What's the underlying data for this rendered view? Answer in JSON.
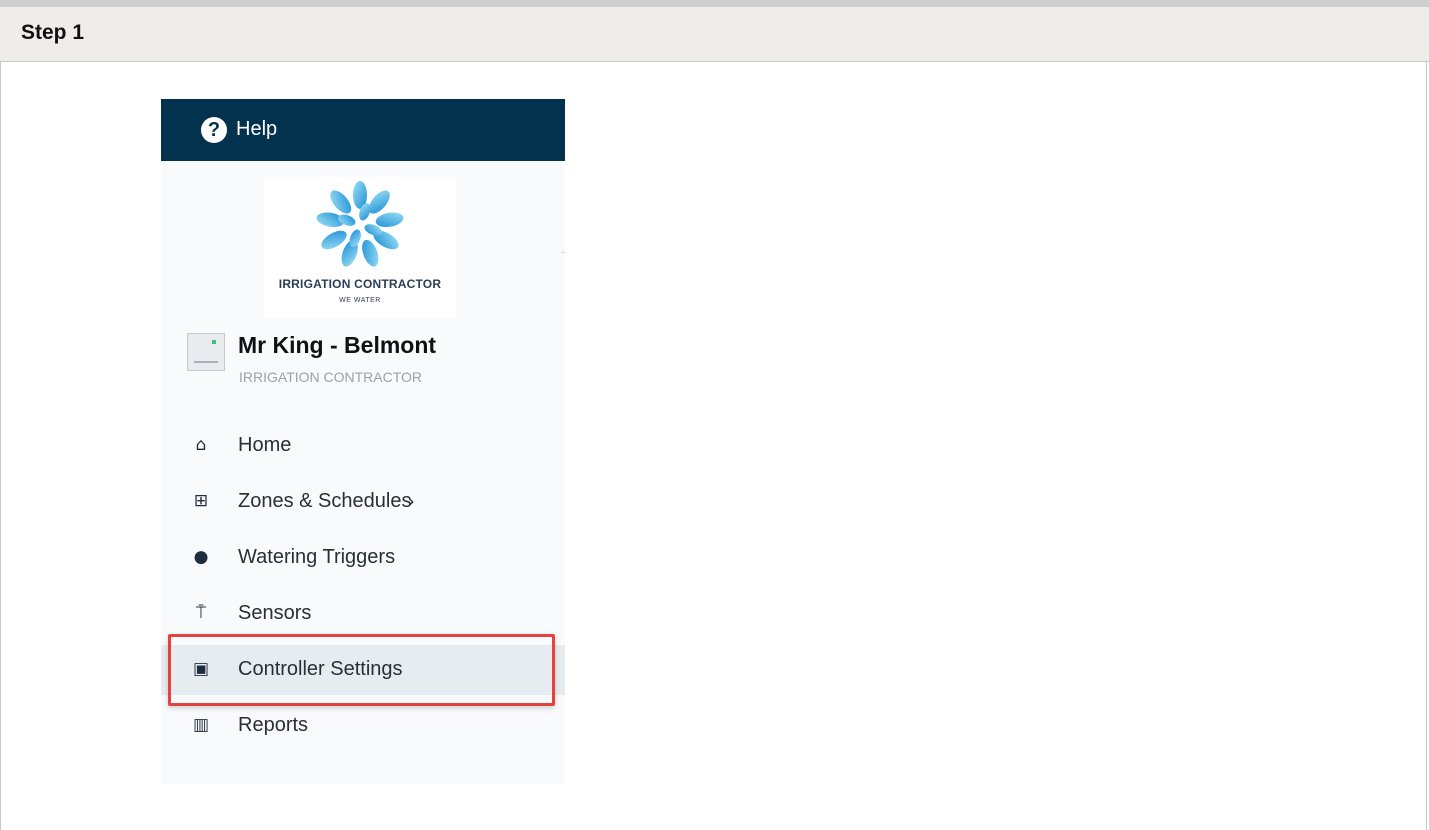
{
  "step": {
    "title": "Step 1"
  },
  "app": {
    "help": {
      "label": "Help",
      "icon": "question-circle-icon"
    },
    "logo": {
      "name": "IRRIGATION CONTRACTOR",
      "tagline": "WE WATER",
      "icon": "water-splash-icon"
    },
    "controller": {
      "name": "Mr King - Belmont",
      "company": "IRRIGATION CONTRACTOR",
      "icon": "controller-device-icon"
    },
    "nav": [
      {
        "label": "Home",
        "icon": "home-icon",
        "glyph": "⌂"
      },
      {
        "label": "Zones & Schedules",
        "icon": "grid-icon",
        "glyph": "⊞",
        "chevron": "›"
      },
      {
        "label": "Watering Triggers",
        "icon": "trigger-icon",
        "glyph": "●"
      },
      {
        "label": "Sensors",
        "icon": "antenna-icon",
        "glyph": "⍑"
      },
      {
        "label": "Controller Settings",
        "icon": "controller-settings-icon",
        "glyph": "▣",
        "highlighted": true
      },
      {
        "label": "Reports",
        "icon": "chart-icon",
        "glyph": "▥"
      }
    ]
  },
  "colors": {
    "help_bar": "#03324f",
    "highlight": "#e5413f",
    "header_bg": "#efedea"
  }
}
